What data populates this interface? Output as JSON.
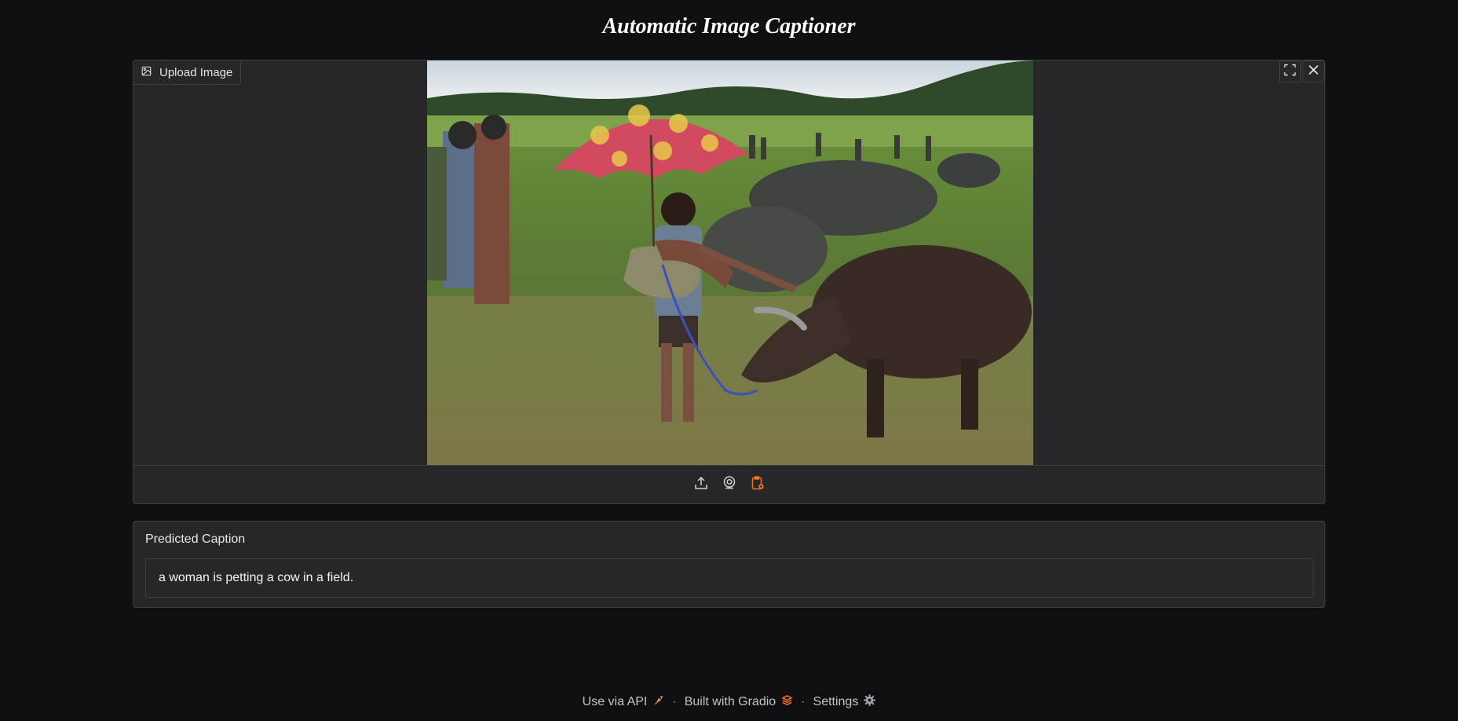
{
  "app": {
    "title": "Automatic Image Captioner"
  },
  "image_input": {
    "label": "Upload Image",
    "icons": {
      "label_icon": "image-icon",
      "fullscreen": "fullscreen-icon",
      "clear": "close-icon",
      "upload": "upload-icon",
      "webcam": "webcam-icon",
      "clipboard": "clipboard-paste-icon"
    },
    "accent_color": "#f97316"
  },
  "output": {
    "label": "Predicted Caption",
    "value": "a woman is petting a cow in a field."
  },
  "footer": {
    "api_label": "Use via API",
    "gradio_label": "Built with Gradio",
    "settings_label": "Settings",
    "separator": "·"
  }
}
